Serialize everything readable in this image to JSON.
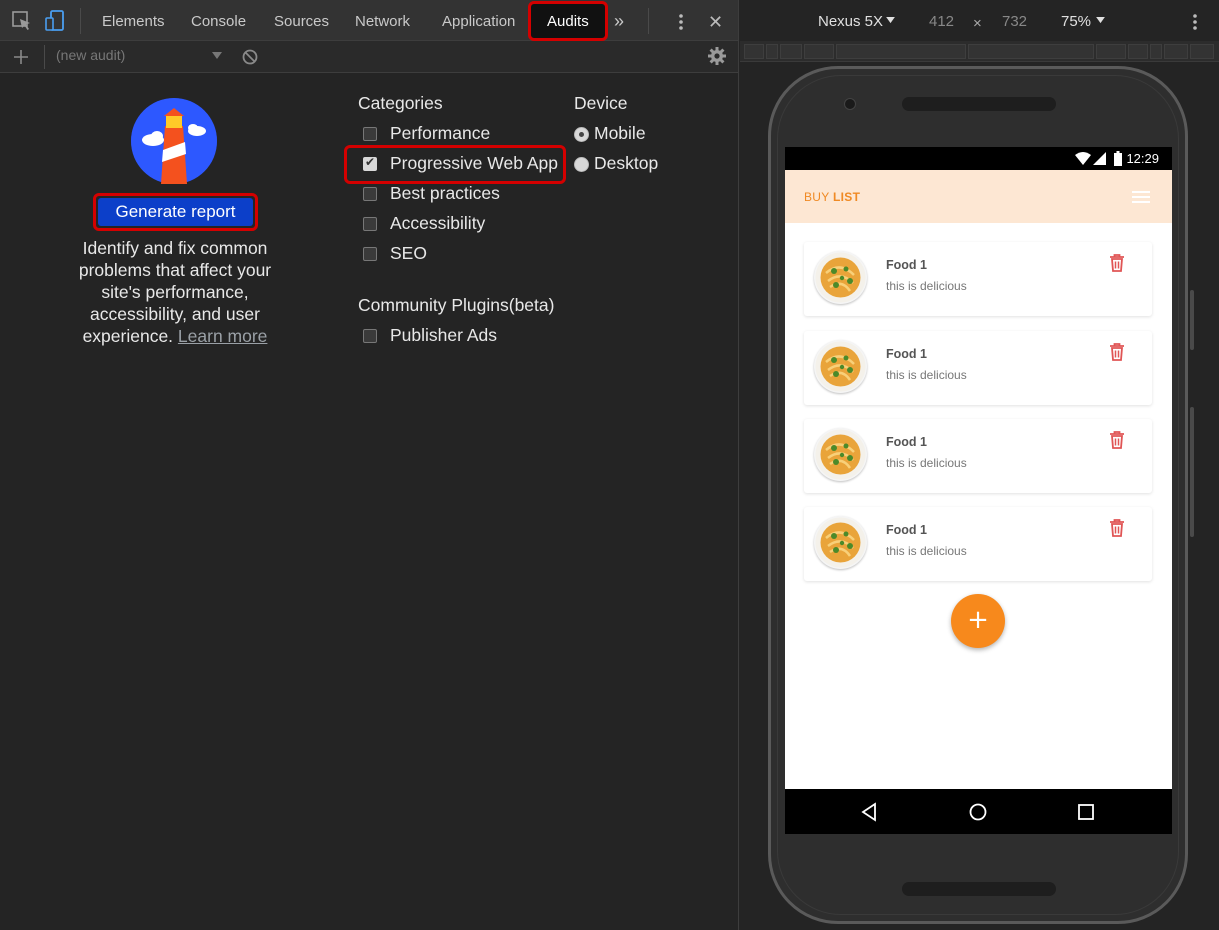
{
  "devtools": {
    "tabs": [
      "Elements",
      "Console",
      "Sources",
      "Network",
      "Application",
      "Audits"
    ],
    "more_tabs_icon": "»",
    "close_icon": "✕",
    "audit_select_placeholder": "(new audit)",
    "generate_label": "Generate report",
    "description": "Identify and fix common problems that affect your site's performance, accessibility, and user experience.",
    "learn_more": "Learn more",
    "categories_title": "Categories",
    "categories": [
      {
        "label": "Performance",
        "checked": false
      },
      {
        "label": "Progressive Web App",
        "checked": true
      },
      {
        "label": "Best practices",
        "checked": false
      },
      {
        "label": "Accessibility",
        "checked": false
      },
      {
        "label": "SEO",
        "checked": false
      }
    ],
    "plugins_title": "Community Plugins(beta)",
    "plugins": [
      {
        "label": "Publisher Ads",
        "checked": false
      }
    ],
    "device_title": "Device",
    "devices": [
      {
        "label": "Mobile",
        "selected": true
      },
      {
        "label": "Desktop",
        "selected": false
      }
    ]
  },
  "emulation": {
    "device_name": "Nexus 5X",
    "width": "412",
    "times": "×",
    "height": "732",
    "zoom": "75%"
  },
  "app": {
    "time": "12:29",
    "title_buy": "BUY",
    "title_list": "LIST",
    "items": [
      {
        "name": "Food 1",
        "desc": "this is delicious"
      },
      {
        "name": "Food 1",
        "desc": "this is delicious"
      },
      {
        "name": "Food 1",
        "desc": "this is delicious"
      },
      {
        "name": "Food 1",
        "desc": "this is delicious"
      }
    ],
    "fab_label": "+"
  },
  "colors": {
    "highlight": "#d40000",
    "generate_button": "#0c3fc9",
    "app_accent": "#f08a24",
    "appbar_bg": "#fde7d3",
    "trash": "#e05555"
  }
}
